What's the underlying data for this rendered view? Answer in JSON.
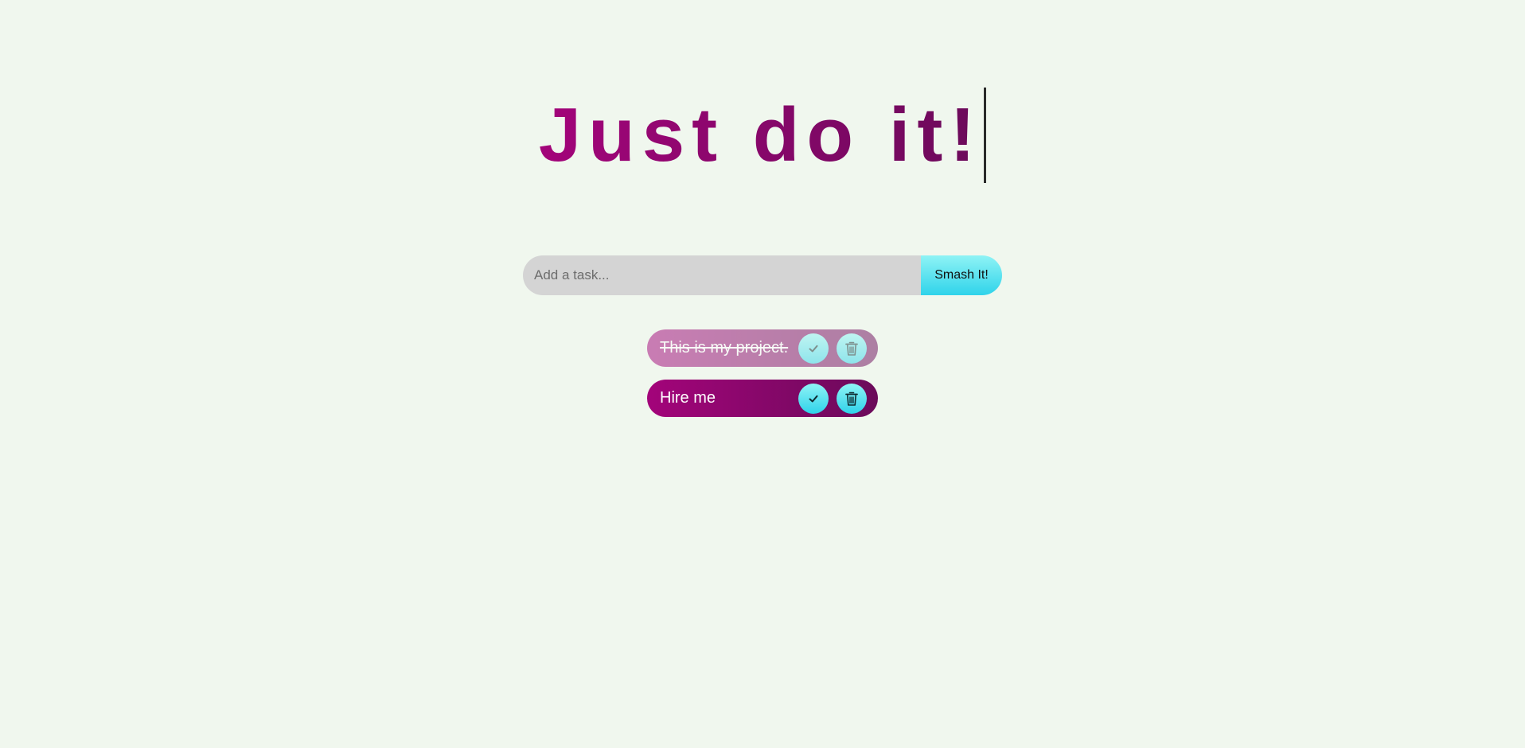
{
  "header": {
    "title": "Just do it!"
  },
  "form": {
    "placeholder": "Add a task...",
    "value": "",
    "submit_label": "Smash It!"
  },
  "todos": [
    {
      "text": "This is my project.",
      "completed": true,
      "check_icon": "check-icon",
      "delete_icon": "trash-icon"
    },
    {
      "text": "Hire me",
      "completed": false,
      "check_icon": "check-icon",
      "delete_icon": "trash-icon"
    }
  ],
  "colors": {
    "background": "#f0f7ee",
    "accent_start": "#a3047a",
    "accent_end": "#6b0a5a",
    "button_start": "#8ff3f5",
    "button_end": "#2fd3ea",
    "input_background": "#d4d4d4"
  }
}
